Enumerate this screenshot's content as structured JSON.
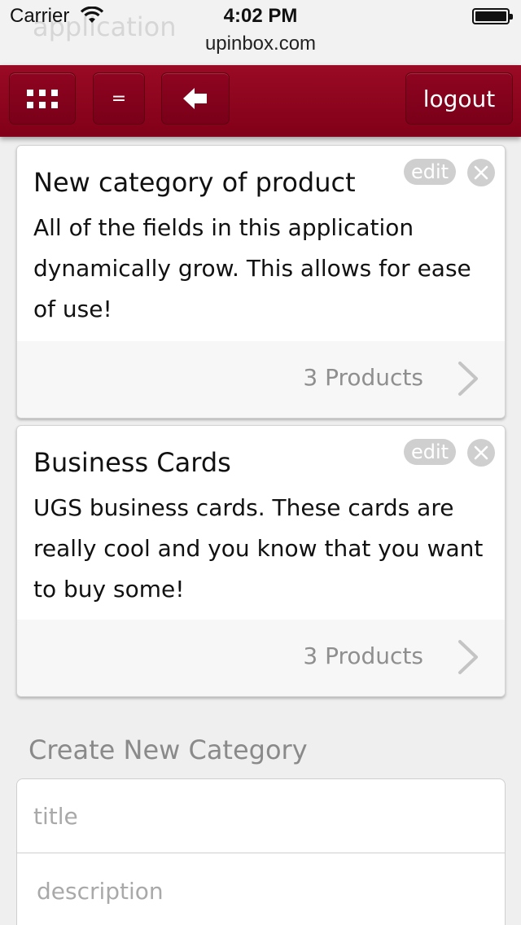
{
  "status_bar": {
    "carrier": "Carrier",
    "time": "4:02 PM",
    "url": "upinbox.com",
    "ghost_page_title": "application"
  },
  "toolbar": {
    "grid_icon": "grid-icon",
    "menu_label": "=",
    "back_icon": "back-arrow-icon",
    "logout_label": "logout",
    "accent_color": "#8c0020"
  },
  "categories": [
    {
      "title": "New category of product",
      "description": "All of the fields in this application dynamically grow. This allows for ease of use!",
      "edit_label": "edit",
      "products_label": "3 Products"
    },
    {
      "title": "Business Cards",
      "description": "UGS business cards. These cards are really cool and you know that you want to buy some!",
      "edit_label": "edit",
      "products_label": "3 Products"
    }
  ],
  "create_section": {
    "heading": "Create New Category",
    "title_placeholder": "title",
    "description_placeholder": "description"
  }
}
